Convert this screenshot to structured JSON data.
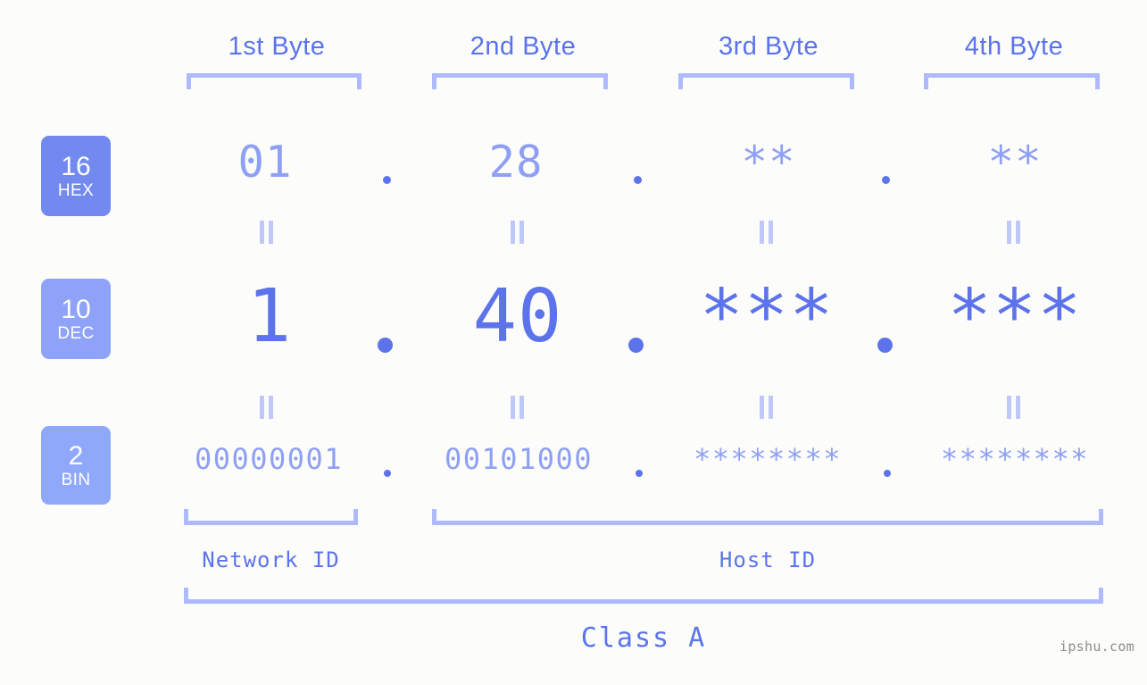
{
  "background_color": "#fcfdfa",
  "accent_color": "#5c73eb",
  "muted_accent_color": "#8fa0f4",
  "bracket_color": "#aebafc",
  "byte_headers": [
    {
      "label": "1st Byte"
    },
    {
      "label": "2nd Byte"
    },
    {
      "label": "3rd Byte"
    },
    {
      "label": "4th Byte"
    }
  ],
  "rows": [
    {
      "badge_number": "16",
      "badge_unit": "HEX",
      "badge_color": "#7289f0",
      "values": [
        "01",
        "28",
        "**",
        "**"
      ],
      "separator": "."
    },
    {
      "badge_number": "10",
      "badge_unit": "DEC",
      "badge_color": "#8ea3f7",
      "values": [
        "1",
        "40",
        "***",
        "***"
      ],
      "separator": "."
    },
    {
      "badge_number": "2",
      "badge_unit": "BIN",
      "badge_color": "#8fa8fa",
      "values": [
        "00000001",
        "00101000",
        "********",
        "********"
      ],
      "separator": "."
    }
  ],
  "id_sections": [
    {
      "label": "Network ID"
    },
    {
      "label": "Host ID"
    }
  ],
  "class_label": "Class A",
  "watermark": "ipshu.com"
}
